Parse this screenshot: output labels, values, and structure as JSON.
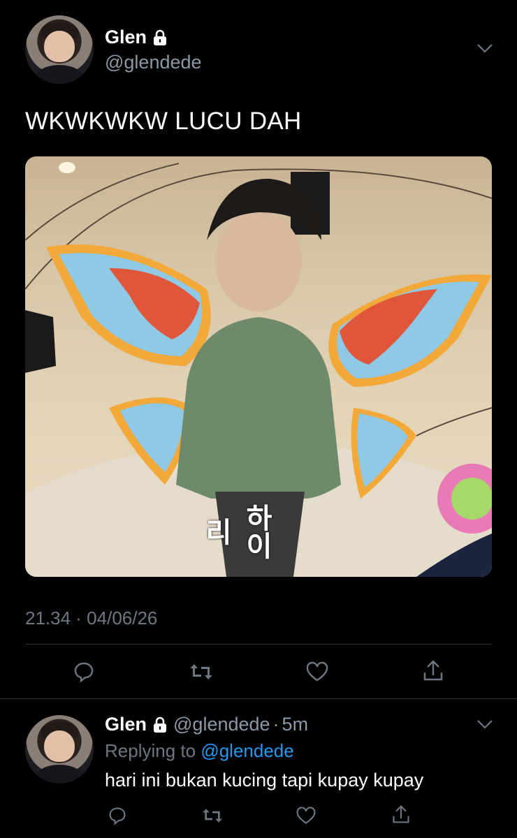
{
  "tweet": {
    "author_name": "Glen",
    "author_handle": "@glendede",
    "text": "WKWKWKW LUCU DAH",
    "media_text": "하이리",
    "timestamp": "21.34 · 04/06/26",
    "actions": [
      "reply-icon",
      "retweet-icon",
      "like-icon",
      "share-icon"
    ]
  },
  "reply": {
    "author_name": "Glen",
    "author_handle": "@glendede",
    "separator": "·",
    "age": "5m",
    "replying_prefix": "Replying to",
    "replying_handle": "@glendede",
    "text": "hari ini bukan kucing tapi kupay kupay",
    "actions": [
      "reply-icon",
      "retweet-icon",
      "like-icon",
      "share-icon"
    ]
  },
  "colors": {
    "background": "#000000",
    "text": "#ffffff",
    "muted": "#6e7781",
    "link": "#1d9bf0",
    "divider": "#2f3336"
  }
}
